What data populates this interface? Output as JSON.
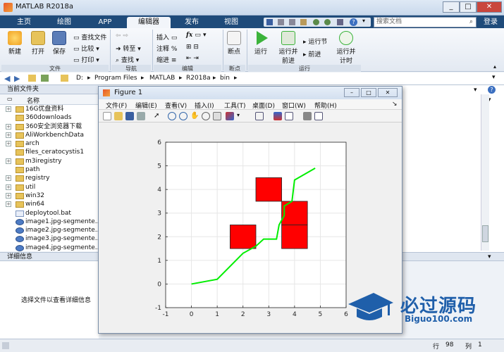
{
  "window": {
    "title": "MATLAB R2018a"
  },
  "tabs": [
    "主页",
    "绘图",
    "APP",
    "编辑器",
    "发布",
    "视图"
  ],
  "active_tab": "编辑器",
  "search": {
    "placeholder": "搜索文档"
  },
  "login_label": "登录",
  "ribbon": {
    "file": {
      "new": "新建",
      "open": "打开",
      "save": "保存",
      "find_files": "查找文件",
      "compare": "比较",
      "print": "打印",
      "section": "文件"
    },
    "navigate": {
      "goto": "转至",
      "find": "查找",
      "section": "导航"
    },
    "edit": {
      "insert": "插入",
      "comment": "注释",
      "indent": "缩进",
      "fx": "fx",
      "section": "编辑"
    },
    "breakpoints": {
      "breakpoints": "断点",
      "section": "断点"
    },
    "run": {
      "run": "运行",
      "run_advance": "运行并前进",
      "run_section": "运行节",
      "advance": "前进",
      "run_time": "运行并计时",
      "section": "运行"
    }
  },
  "address": {
    "crumbs": [
      "D:",
      "Program Files",
      "MATLAB",
      "R2018a",
      "bin"
    ]
  },
  "current_folder": {
    "header": "当前文件夹",
    "column": "名称",
    "files": [
      {
        "name": "16G优盘资料",
        "type": "folder",
        "expand": true
      },
      {
        "name": "360downloads",
        "type": "folder",
        "expand": false
      },
      {
        "name": "360安全浏览器下载",
        "type": "folder",
        "expand": true
      },
      {
        "name": "AliWorkbenchData",
        "type": "folder",
        "expand": true
      },
      {
        "name": "arch",
        "type": "folder",
        "expand": true
      },
      {
        "name": "files_ceratocystis1",
        "type": "folder",
        "expand": false
      },
      {
        "name": "m3iregistry",
        "type": "folder",
        "expand": true
      },
      {
        "name": "path",
        "type": "folder",
        "expand": false
      },
      {
        "name": "registry",
        "type": "folder",
        "expand": true
      },
      {
        "name": "util",
        "type": "folder",
        "expand": true
      },
      {
        "name": "win32",
        "type": "folder",
        "expand": true
      },
      {
        "name": "win64",
        "type": "folder",
        "expand": true
      },
      {
        "name": "deploytool.bat",
        "type": "m",
        "expand": false
      },
      {
        "name": "image1.jpg-segmente...",
        "type": "jpg",
        "expand": false
      },
      {
        "name": "image2.jpg-segmente...",
        "type": "jpg",
        "expand": false
      },
      {
        "name": "image3.jpg-segmente...",
        "type": "jpg",
        "expand": false
      },
      {
        "name": "image4.jpg-segmente...",
        "type": "jpg",
        "expand": false
      }
    ]
  },
  "details": {
    "header": "详细信息",
    "message": "选择文件以查看详细信息"
  },
  "status": {
    "row_label": "行",
    "row": "98",
    "col_label": "列",
    "col": "1"
  },
  "figure": {
    "title": "Figure 1",
    "menu": [
      "文件(F)",
      "编辑(E)",
      "查看(V)",
      "插入(I)",
      "工具(T)",
      "桌面(D)",
      "窗口(W)",
      "帮助(H)"
    ]
  },
  "chart_data": {
    "type": "line",
    "title": "",
    "xlabel": "",
    "ylabel": "",
    "xlim": [
      -1,
      6
    ],
    "ylim": [
      -1,
      6
    ],
    "xticks": [
      -1,
      0,
      1,
      2,
      3,
      4,
      5,
      6
    ],
    "yticks": [
      -1,
      0,
      1,
      2,
      3,
      4,
      5,
      6
    ],
    "grid": true,
    "series": [
      {
        "color": "#00ee00",
        "x": [
          0,
          1,
          2,
          2.5,
          2.8,
          3.3,
          3.4,
          3.6,
          3.6,
          3.9,
          4.0,
          4.8
        ],
        "y": [
          0,
          0.2,
          1.3,
          1.6,
          1.9,
          1.9,
          2.5,
          2.9,
          3.3,
          3.5,
          4.4,
          4.9
        ]
      }
    ],
    "rectangles": [
      {
        "x": 1.5,
        "y": 1.5,
        "w": 1,
        "h": 1,
        "fill": "#ff0000"
      },
      {
        "x": 2.5,
        "y": 3.5,
        "w": 1,
        "h": 1,
        "fill": "#ff0000"
      },
      {
        "x": 3.5,
        "y": 2.5,
        "w": 1,
        "h": 1,
        "fill": "#ff0000"
      },
      {
        "x": 3.5,
        "y": 1.5,
        "w": 1,
        "h": 1,
        "fill": "#ff0000"
      }
    ]
  },
  "watermark": {
    "text": "必过源码",
    "url": "Biguo100.com"
  },
  "colors": {
    "tabbar": "#1f4b7a",
    "accent": "#f2f5fa"
  }
}
